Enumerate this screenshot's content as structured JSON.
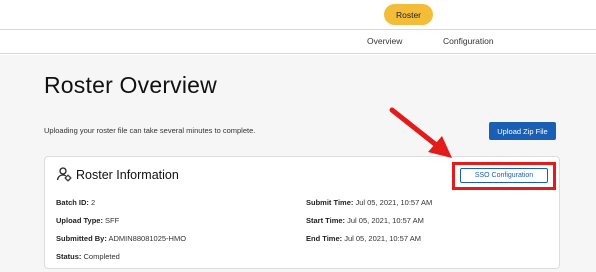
{
  "header": {
    "roster_button": "Roster"
  },
  "nav": {
    "tabs": [
      {
        "label": "Overview"
      },
      {
        "label": "Configuration"
      }
    ]
  },
  "main": {
    "title": "Roster Overview",
    "subtitle": "Uploading your roster file can take several minutes to complete.",
    "upload_button": "Upload Zip File"
  },
  "card": {
    "title": "Roster Information",
    "sso_button": "SSO Configuration",
    "fields": {
      "batch_id": {
        "label": "Batch ID:",
        "value": "2"
      },
      "upload_type": {
        "label": "Upload Type:",
        "value": "SFF"
      },
      "submitted_by": {
        "label": "Submitted By:",
        "value": "ADMIN88081025-HMO"
      },
      "status": {
        "label": "Status:",
        "value": "Completed"
      },
      "submit_time": {
        "label": "Submit Time:",
        "value": "Jul 05, 2021, 10:57 AM"
      },
      "start_time": {
        "label": "Start Time:",
        "value": "Jul 05, 2021, 10:57 AM"
      },
      "end_time": {
        "label": "End Time:",
        "value": "Jul 05, 2021, 10:57 AM"
      }
    }
  },
  "colors": {
    "accent": "#f4bd39",
    "primary": "#1a5fb4",
    "annotation": "#e31b1b"
  },
  "icons": {
    "card_icon": "user-settings-icon",
    "annotation_arrow": "arrow-icon"
  }
}
